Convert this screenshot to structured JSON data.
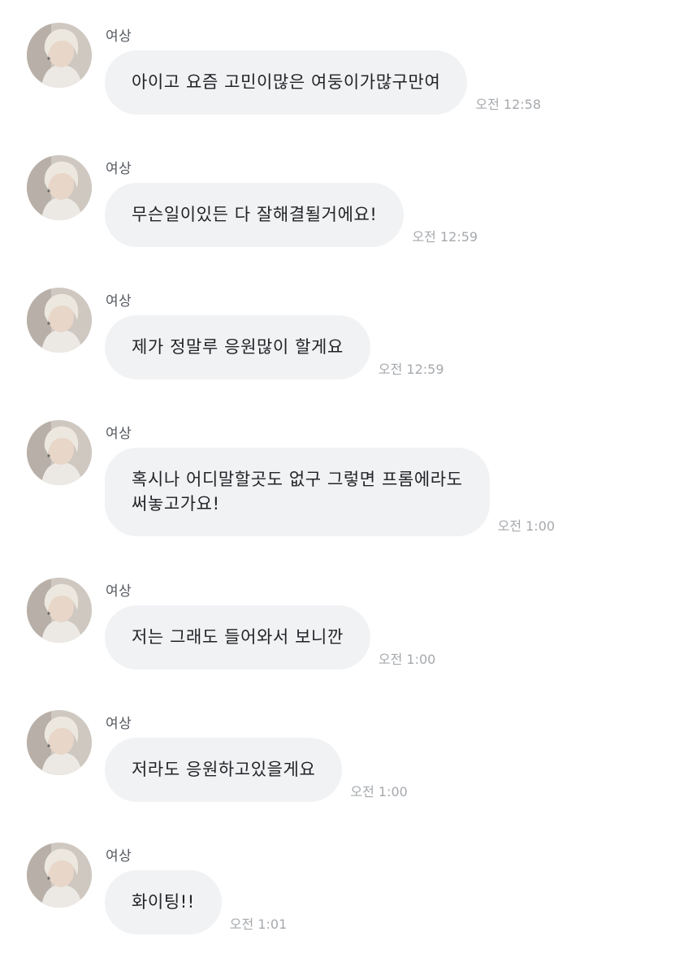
{
  "sender": "여상",
  "messages": [
    {
      "text": "아이고 요즘 고민이많은 여둥이가많구만여",
      "time": "오전 12:58"
    },
    {
      "text": "무슨일이있든 다 잘해결될거에요!",
      "time": "오전 12:59"
    },
    {
      "text": "제가 정말루 응원많이 할게요",
      "time": "오전 12:59"
    },
    {
      "text": "혹시나 어디말할곳도 없구 그렇면 프롬에라도\n써놓고가요!",
      "time": "오전 1:00"
    },
    {
      "text": "저는 그래도 들어와서 보니깐",
      "time": "오전 1:00"
    },
    {
      "text": "저라도 응원하고있을게요",
      "time": "오전 1:00"
    },
    {
      "text": "화이팅!!",
      "time": "오전 1:01"
    }
  ]
}
